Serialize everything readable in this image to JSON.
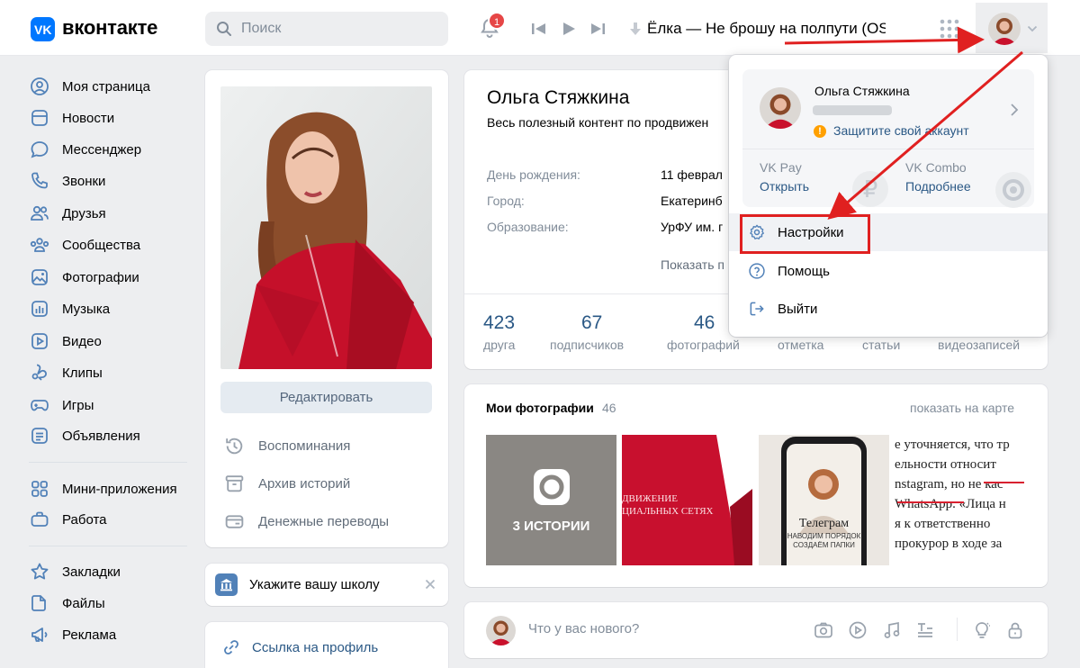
{
  "header": {
    "logo_text": "вконтакте",
    "search_placeholder": "Поиск",
    "notifications_count": "1",
    "now_playing": "Ёлка — Не брошу на полпути (OS..."
  },
  "nav": {
    "main": [
      {
        "label": "Моя страница",
        "icon": "user-circle-icon"
      },
      {
        "label": "Новости",
        "icon": "news-icon"
      },
      {
        "label": "Мессенджер",
        "icon": "message-icon"
      },
      {
        "label": "Звонки",
        "icon": "phone-icon"
      },
      {
        "label": "Друзья",
        "icon": "friends-icon"
      },
      {
        "label": "Сообщества",
        "icon": "communities-icon"
      },
      {
        "label": "Фотографии",
        "icon": "photo-icon"
      },
      {
        "label": "Музыка",
        "icon": "music-icon"
      },
      {
        "label": "Видео",
        "icon": "video-icon"
      },
      {
        "label": "Клипы",
        "icon": "clips-icon"
      },
      {
        "label": "Игры",
        "icon": "gamepad-icon"
      },
      {
        "label": "Объявления",
        "icon": "ads-icon"
      }
    ],
    "apps": [
      {
        "label": "Мини-приложения",
        "icon": "apps-grid-icon"
      },
      {
        "label": "Работа",
        "icon": "briefcase-icon"
      }
    ],
    "extra": [
      {
        "label": "Закладки",
        "icon": "star-icon"
      },
      {
        "label": "Файлы",
        "icon": "file-icon"
      },
      {
        "label": "Реклама",
        "icon": "megaphone-icon"
      }
    ]
  },
  "profile": {
    "edit_button": "Редактировать",
    "left_menu": [
      {
        "label": "Воспоминания",
        "icon": "history-icon"
      },
      {
        "label": "Архив историй",
        "icon": "archive-icon"
      },
      {
        "label": "Денежные переводы",
        "icon": "money-transfer-icon"
      }
    ],
    "school_prompt": "Укажите вашу школу",
    "profile_link": "Ссылка на профиль",
    "name": "Ольга Стяжкина",
    "status": "Весь полезный контент по продвижен",
    "info": [
      {
        "label": "День рождения:",
        "value": "11 феврал"
      },
      {
        "label": "Город:",
        "value": "Екатеринб"
      },
      {
        "label": "Образование:",
        "value": "УрФУ им. г"
      }
    ],
    "show_more": "Показать п",
    "stats": [
      {
        "num": "423",
        "label": "друга"
      },
      {
        "num": "67",
        "label": "подписчиков"
      },
      {
        "num": "46",
        "label": "фотографий"
      },
      {
        "num": "",
        "label": "отметка"
      },
      {
        "num": "",
        "label": "статьи"
      },
      {
        "num": "",
        "label": "видеозаписей"
      }
    ]
  },
  "photos": {
    "title": "Мои фотографии",
    "count": "46",
    "map_link": "показать на карте",
    "stories_label": "3 ИСТОРИИ",
    "thumb2_text": "ДВИЖЕНИЕ\nЦИАЛЬНЫХ СЕТЯХ",
    "thumb3_title": "Телеграм",
    "thumb3_sub": "НАВОДИМ ПОРЯДОК\nСОЗДАЁМ ПАПКИ",
    "thumb4_lines": [
      "е уточняется, что тр",
      "ельности относит",
      "nstagram, но не кас",
      "WhatsApp. «Лица н",
      "я к ответственно",
      "прокурор в ходе за"
    ]
  },
  "post": {
    "placeholder": "Что у вас нового?"
  },
  "dropdown": {
    "user_name": "Ольга Стяжкина",
    "protect_text": "Защитите свой аккаунт",
    "vkpay_title": "VK Pay",
    "vkpay_action": "Открыть",
    "combo_title": "VK Combo",
    "combo_action": "Подробнее",
    "items": [
      {
        "label": "Настройки",
        "icon": "gear-icon"
      },
      {
        "label": "Помощь",
        "icon": "help-icon"
      },
      {
        "label": "Выйти",
        "icon": "logout-icon"
      }
    ]
  },
  "colors": {
    "accent": "#0077ff",
    "link": "#2a5885",
    "highlight": "#e02020",
    "warning": "#ffa000"
  }
}
